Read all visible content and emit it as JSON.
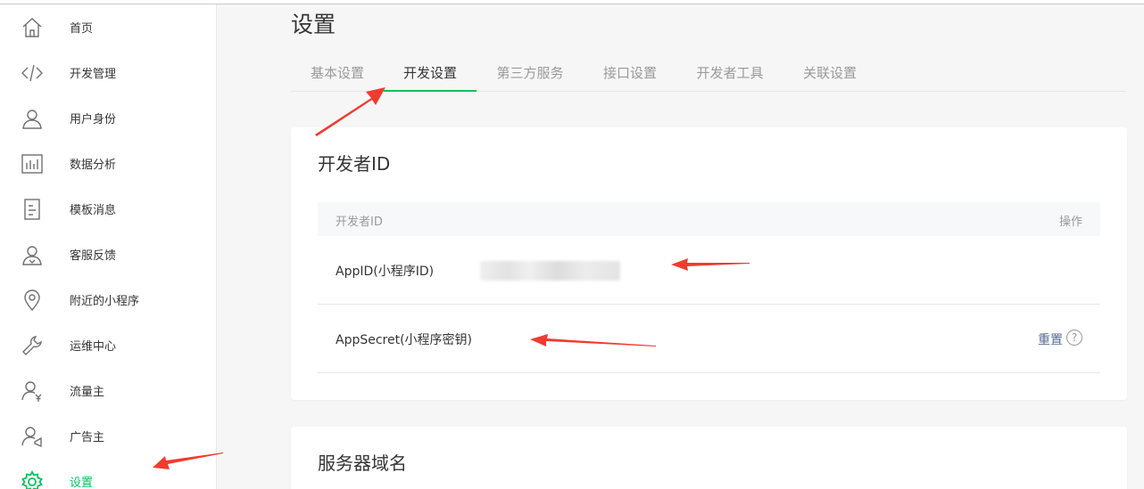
{
  "sidebar": {
    "items": [
      {
        "label": "首页",
        "icon": "home-icon"
      },
      {
        "label": "开发管理",
        "icon": "code-icon"
      },
      {
        "label": "用户身份",
        "icon": "user-icon"
      },
      {
        "label": "数据分析",
        "icon": "bar-chart-icon"
      },
      {
        "label": "模板消息",
        "icon": "document-icon"
      },
      {
        "label": "客服反馈",
        "icon": "customer-service-icon"
      },
      {
        "label": "附近的小程序",
        "icon": "location-pin-icon"
      },
      {
        "label": "运维中心",
        "icon": "wrench-icon"
      },
      {
        "label": "流量主",
        "icon": "user-yen-icon"
      },
      {
        "label": "广告主",
        "icon": "user-megaphone-icon"
      },
      {
        "label": "设置",
        "icon": "gear-icon",
        "active": true
      }
    ]
  },
  "main": {
    "title": "设置",
    "tabs": [
      {
        "label": "基本设置"
      },
      {
        "label": "开发设置",
        "active": true
      },
      {
        "label": "第三方服务"
      },
      {
        "label": "接口设置"
      },
      {
        "label": "开发者工具"
      },
      {
        "label": "关联设置"
      }
    ],
    "developer_card": {
      "title": "开发者ID",
      "header_left": "开发者ID",
      "header_right": "操作",
      "rows": [
        {
          "name": "AppID(小程序ID)",
          "value_state": "blurred"
        },
        {
          "name": "AppSecret(小程序密钥)",
          "action": "重置",
          "help": "?"
        }
      ]
    },
    "server_card": {
      "title": "服务器域名"
    }
  },
  "colors": {
    "accent": "#07c160",
    "link": "#576b95",
    "annotation_arrow": "#f03b2f",
    "background": "#f6f6f6"
  }
}
